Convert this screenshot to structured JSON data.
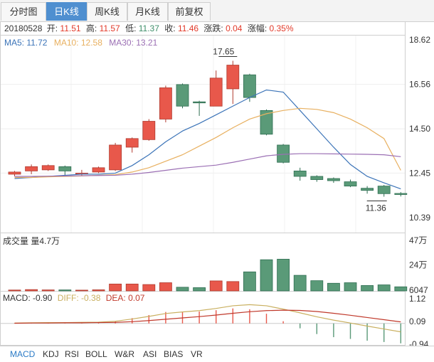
{
  "tabs": [
    {
      "label": "分时图",
      "active": false
    },
    {
      "label": "日K线",
      "active": true
    },
    {
      "label": "周K线",
      "active": false
    },
    {
      "label": "月K线",
      "active": false
    },
    {
      "label": "前复权",
      "active": false
    }
  ],
  "info": {
    "date": "20180528",
    "open_label": "开:",
    "open": "11.51",
    "high_label": "高:",
    "high": "11.57",
    "low_label": "低:",
    "low": "11.37",
    "close_label": "收:",
    "close": "11.46",
    "change_label": "涨跌:",
    "change": "0.04",
    "pct_label": "涨幅:",
    "pct": "0.35%"
  },
  "ma_legend": {
    "ma5": "MA5: 11.72",
    "ma10": "MA10: 12.58",
    "ma30": "MA30: 13.21"
  },
  "volume_legend": "成交量 量4.7万",
  "macd_legend": {
    "macd": "MACD: -0.90",
    "diff": "DIFF: -0.38",
    "dea": "DEA: 0.07"
  },
  "indicator_tabs": [
    {
      "label": "MACD",
      "active": true
    },
    {
      "label": "KDJ",
      "active": false
    },
    {
      "label": "RSI",
      "active": false
    },
    {
      "label": "BOLL",
      "active": false
    },
    {
      "label": "W&R",
      "active": false
    },
    {
      "label": "ASI",
      "active": false
    },
    {
      "label": "BIAS",
      "active": false
    },
    {
      "label": "VR",
      "active": false
    }
  ],
  "colors": {
    "up": "#e8584b",
    "down": "#5a9a78",
    "ma5": "#3c74b8",
    "ma10": "#e8b060",
    "ma30": "#9b6fb4",
    "diff": "#c9b060",
    "dea": "#c0392b",
    "info_red": "#e23a2a",
    "info_green": "#3f8f6a"
  },
  "chart_data": {
    "type": "candlestick",
    "price_axis": {
      "ticks": [
        "18.62",
        "16.56",
        "14.50",
        "12.45",
        "10.39"
      ],
      "range": [
        10.39,
        18.62
      ]
    },
    "volume_axis": {
      "ticks": [
        "47万",
        "24万",
        "6047"
      ],
      "range": [
        0,
        47
      ]
    },
    "macd_axis": {
      "ticks": [
        "1.12",
        "0.09",
        "-0.94"
      ],
      "range": [
        -0.94,
        1.12
      ]
    },
    "high_marker": "17.65",
    "low_marker": "11.36",
    "candles": [
      {
        "o": 12.4,
        "c": 12.5,
        "h": 12.55,
        "l": 12.3,
        "v": 0.8
      },
      {
        "o": 12.55,
        "c": 12.75,
        "h": 12.85,
        "l": 12.4,
        "v": 1.2
      },
      {
        "o": 12.6,
        "c": 12.8,
        "h": 12.85,
        "l": 12.55,
        "v": 0.9
      },
      {
        "o": 12.75,
        "c": 12.55,
        "h": 12.8,
        "l": 12.3,
        "v": 0.9
      },
      {
        "o": 12.4,
        "c": 12.45,
        "h": 12.6,
        "l": 12.35,
        "v": 0.7
      },
      {
        "o": 12.5,
        "c": 12.7,
        "h": 12.75,
        "l": 12.45,
        "v": 1.0
      },
      {
        "o": 12.6,
        "c": 13.75,
        "h": 13.85,
        "l": 12.55,
        "v": 6.4
      },
      {
        "o": 13.65,
        "c": 14.05,
        "h": 14.1,
        "l": 13.4,
        "v": 6.4
      },
      {
        "o": 14.0,
        "c": 14.85,
        "h": 14.95,
        "l": 13.95,
        "v": 5.9
      },
      {
        "o": 14.95,
        "c": 16.4,
        "h": 16.5,
        "l": 14.8,
        "v": 7.6
      },
      {
        "o": 16.55,
        "c": 15.55,
        "h": 16.6,
        "l": 15.45,
        "v": 3.4
      },
      {
        "o": 15.75,
        "c": 15.7,
        "h": 15.8,
        "l": 15.1,
        "v": 3.0
      },
      {
        "o": 15.55,
        "c": 16.85,
        "h": 17.2,
        "l": 15.55,
        "v": 9.3
      },
      {
        "o": 16.35,
        "c": 17.45,
        "h": 17.65,
        "l": 15.65,
        "v": 8.7
      },
      {
        "o": 17.0,
        "c": 15.95,
        "h": 17.05,
        "l": 15.75,
        "v": 17.7
      },
      {
        "o": 15.35,
        "c": 14.25,
        "h": 15.4,
        "l": 14.2,
        "v": 29.0
      },
      {
        "o": 13.75,
        "c": 12.95,
        "h": 13.8,
        "l": 12.9,
        "v": 29.5
      },
      {
        "o": 12.55,
        "c": 12.3,
        "h": 12.7,
        "l": 12.1,
        "v": 14.5
      },
      {
        "o": 12.3,
        "c": 12.15,
        "h": 12.35,
        "l": 12.05,
        "v": 9.5
      },
      {
        "o": 12.2,
        "c": 12.1,
        "h": 12.25,
        "l": 12.0,
        "v": 7.1
      },
      {
        "o": 12.05,
        "c": 11.85,
        "h": 12.15,
        "l": 11.8,
        "v": 7.6
      },
      {
        "o": 11.75,
        "c": 11.65,
        "h": 11.85,
        "l": 11.5,
        "v": 5.0
      },
      {
        "o": 11.85,
        "c": 11.5,
        "h": 11.9,
        "l": 11.36,
        "v": 5.6
      },
      {
        "o": 11.51,
        "c": 11.46,
        "h": 11.57,
        "l": 11.37,
        "v": 3.8
      }
    ],
    "ma5": [
      12.2,
      12.25,
      12.3,
      12.35,
      12.4,
      12.4,
      12.45,
      12.8,
      13.3,
      13.9,
      14.4,
      14.75,
      15.15,
      15.55,
      15.95,
      16.3,
      16.2,
      15.35,
      14.5,
      13.65,
      12.85,
      12.3,
      12.0,
      11.72
    ],
    "ma10": [
      12.25,
      12.25,
      12.28,
      12.3,
      12.32,
      12.35,
      12.38,
      12.5,
      12.7,
      13.0,
      13.3,
      13.7,
      14.1,
      14.55,
      14.95,
      15.2,
      15.35,
      15.45,
      15.4,
      15.25,
      14.95,
      14.55,
      14.05,
      12.58
    ],
    "ma30": [
      12.3,
      12.3,
      12.31,
      12.32,
      12.33,
      12.34,
      12.35,
      12.4,
      12.48,
      12.58,
      12.68,
      12.75,
      12.82,
      12.95,
      13.1,
      13.25,
      13.32,
      13.35,
      13.35,
      13.34,
      13.33,
      13.32,
      13.3,
      13.21
    ],
    "diff": [
      0.02,
      0.03,
      0.04,
      0.04,
      0.05,
      0.06,
      0.1,
      0.2,
      0.32,
      0.45,
      0.52,
      0.58,
      0.68,
      0.8,
      0.85,
      0.8,
      0.65,
      0.48,
      0.3,
      0.15,
      0.02,
      -0.12,
      -0.25,
      -0.38
    ],
    "dea": [
      0.01,
      0.02,
      0.02,
      0.03,
      0.03,
      0.04,
      0.05,
      0.08,
      0.13,
      0.19,
      0.25,
      0.31,
      0.38,
      0.46,
      0.53,
      0.58,
      0.6,
      0.59,
      0.54,
      0.46,
      0.37,
      0.27,
      0.17,
      0.07
    ],
    "macd_hist": [
      0.02,
      0.02,
      0.04,
      0.02,
      0.04,
      0.04,
      0.1,
      0.24,
      0.38,
      0.52,
      0.54,
      0.54,
      0.6,
      0.68,
      0.64,
      0.44,
      0.1,
      -0.22,
      -0.48,
      -0.62,
      -0.7,
      -0.78,
      -0.84,
      -0.9
    ]
  }
}
